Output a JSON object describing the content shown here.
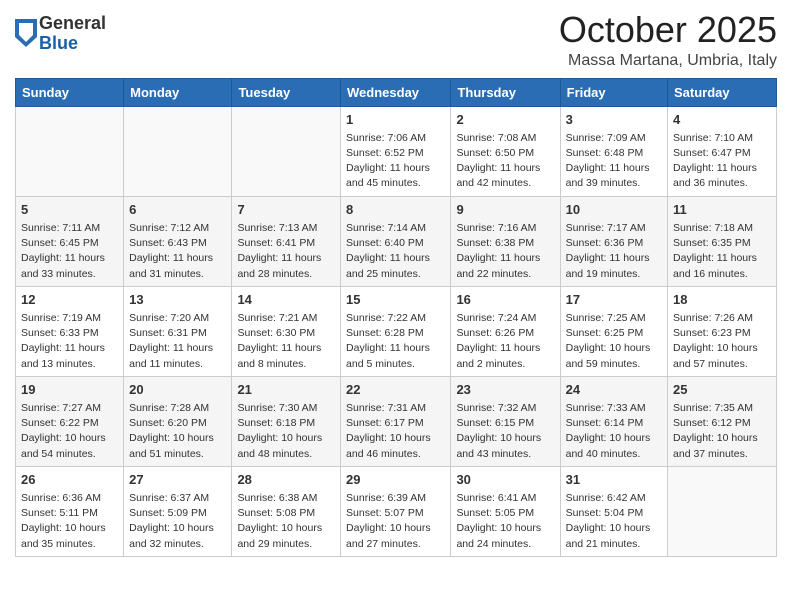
{
  "logo": {
    "general": "General",
    "blue": "Blue"
  },
  "title": {
    "month": "October 2025",
    "location": "Massa Martana, Umbria, Italy"
  },
  "days_of_week": [
    "Sunday",
    "Monday",
    "Tuesday",
    "Wednesday",
    "Thursday",
    "Friday",
    "Saturday"
  ],
  "weeks": [
    [
      {
        "day": "",
        "info": ""
      },
      {
        "day": "",
        "info": ""
      },
      {
        "day": "",
        "info": ""
      },
      {
        "day": "1",
        "info": "Sunrise: 7:06 AM\nSunset: 6:52 PM\nDaylight: 11 hours and 45 minutes."
      },
      {
        "day": "2",
        "info": "Sunrise: 7:08 AM\nSunset: 6:50 PM\nDaylight: 11 hours and 42 minutes."
      },
      {
        "day": "3",
        "info": "Sunrise: 7:09 AM\nSunset: 6:48 PM\nDaylight: 11 hours and 39 minutes."
      },
      {
        "day": "4",
        "info": "Sunrise: 7:10 AM\nSunset: 6:47 PM\nDaylight: 11 hours and 36 minutes."
      }
    ],
    [
      {
        "day": "5",
        "info": "Sunrise: 7:11 AM\nSunset: 6:45 PM\nDaylight: 11 hours and 33 minutes."
      },
      {
        "day": "6",
        "info": "Sunrise: 7:12 AM\nSunset: 6:43 PM\nDaylight: 11 hours and 31 minutes."
      },
      {
        "day": "7",
        "info": "Sunrise: 7:13 AM\nSunset: 6:41 PM\nDaylight: 11 hours and 28 minutes."
      },
      {
        "day": "8",
        "info": "Sunrise: 7:14 AM\nSunset: 6:40 PM\nDaylight: 11 hours and 25 minutes."
      },
      {
        "day": "9",
        "info": "Sunrise: 7:16 AM\nSunset: 6:38 PM\nDaylight: 11 hours and 22 minutes."
      },
      {
        "day": "10",
        "info": "Sunrise: 7:17 AM\nSunset: 6:36 PM\nDaylight: 11 hours and 19 minutes."
      },
      {
        "day": "11",
        "info": "Sunrise: 7:18 AM\nSunset: 6:35 PM\nDaylight: 11 hours and 16 minutes."
      }
    ],
    [
      {
        "day": "12",
        "info": "Sunrise: 7:19 AM\nSunset: 6:33 PM\nDaylight: 11 hours and 13 minutes."
      },
      {
        "day": "13",
        "info": "Sunrise: 7:20 AM\nSunset: 6:31 PM\nDaylight: 11 hours and 11 minutes."
      },
      {
        "day": "14",
        "info": "Sunrise: 7:21 AM\nSunset: 6:30 PM\nDaylight: 11 hours and 8 minutes."
      },
      {
        "day": "15",
        "info": "Sunrise: 7:22 AM\nSunset: 6:28 PM\nDaylight: 11 hours and 5 minutes."
      },
      {
        "day": "16",
        "info": "Sunrise: 7:24 AM\nSunset: 6:26 PM\nDaylight: 11 hours and 2 minutes."
      },
      {
        "day": "17",
        "info": "Sunrise: 7:25 AM\nSunset: 6:25 PM\nDaylight: 10 hours and 59 minutes."
      },
      {
        "day": "18",
        "info": "Sunrise: 7:26 AM\nSunset: 6:23 PM\nDaylight: 10 hours and 57 minutes."
      }
    ],
    [
      {
        "day": "19",
        "info": "Sunrise: 7:27 AM\nSunset: 6:22 PM\nDaylight: 10 hours and 54 minutes."
      },
      {
        "day": "20",
        "info": "Sunrise: 7:28 AM\nSunset: 6:20 PM\nDaylight: 10 hours and 51 minutes."
      },
      {
        "day": "21",
        "info": "Sunrise: 7:30 AM\nSunset: 6:18 PM\nDaylight: 10 hours and 48 minutes."
      },
      {
        "day": "22",
        "info": "Sunrise: 7:31 AM\nSunset: 6:17 PM\nDaylight: 10 hours and 46 minutes."
      },
      {
        "day": "23",
        "info": "Sunrise: 7:32 AM\nSunset: 6:15 PM\nDaylight: 10 hours and 43 minutes."
      },
      {
        "day": "24",
        "info": "Sunrise: 7:33 AM\nSunset: 6:14 PM\nDaylight: 10 hours and 40 minutes."
      },
      {
        "day": "25",
        "info": "Sunrise: 7:35 AM\nSunset: 6:12 PM\nDaylight: 10 hours and 37 minutes."
      }
    ],
    [
      {
        "day": "26",
        "info": "Sunrise: 6:36 AM\nSunset: 5:11 PM\nDaylight: 10 hours and 35 minutes."
      },
      {
        "day": "27",
        "info": "Sunrise: 6:37 AM\nSunset: 5:09 PM\nDaylight: 10 hours and 32 minutes."
      },
      {
        "day": "28",
        "info": "Sunrise: 6:38 AM\nSunset: 5:08 PM\nDaylight: 10 hours and 29 minutes."
      },
      {
        "day": "29",
        "info": "Sunrise: 6:39 AM\nSunset: 5:07 PM\nDaylight: 10 hours and 27 minutes."
      },
      {
        "day": "30",
        "info": "Sunrise: 6:41 AM\nSunset: 5:05 PM\nDaylight: 10 hours and 24 minutes."
      },
      {
        "day": "31",
        "info": "Sunrise: 6:42 AM\nSunset: 5:04 PM\nDaylight: 10 hours and 21 minutes."
      },
      {
        "day": "",
        "info": ""
      }
    ]
  ]
}
